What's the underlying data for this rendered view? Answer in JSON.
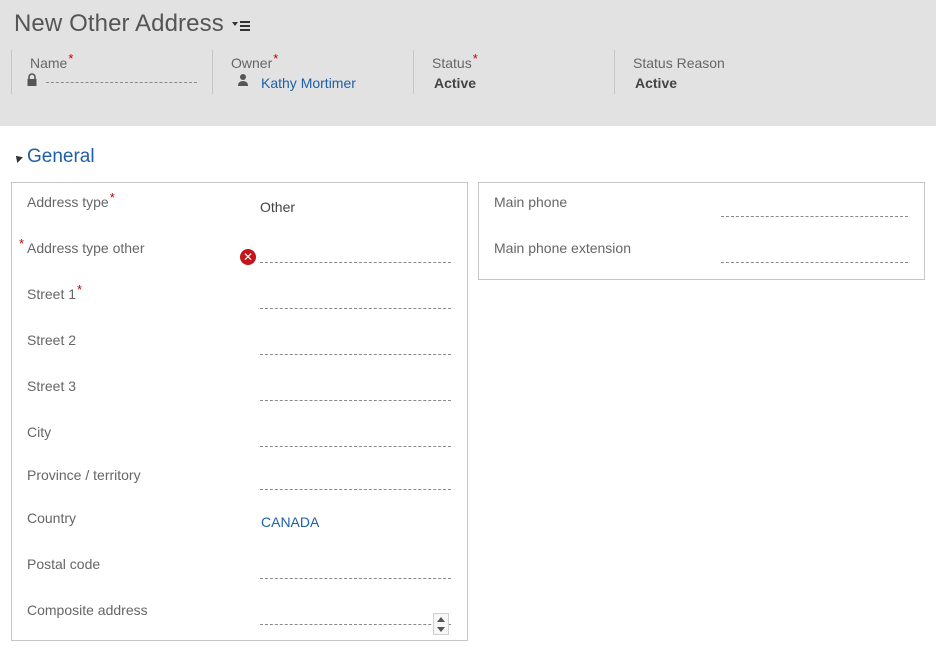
{
  "header": {
    "title": "New Other Address",
    "fields": [
      {
        "label": "Name",
        "required": "*",
        "value": ""
      },
      {
        "label": "Owner",
        "required": "*",
        "value": "Kathy Mortimer"
      },
      {
        "label": "Status",
        "required": "*",
        "value": "Active"
      },
      {
        "label": "Status Reason",
        "required": "",
        "value": "Active"
      }
    ]
  },
  "section": {
    "title": "General"
  },
  "left_fields": [
    {
      "label": "Address type",
      "required": "*",
      "value": "Other"
    },
    {
      "label": "Address type other",
      "required": "*",
      "value": ""
    },
    {
      "label": "Street 1",
      "required": "*",
      "value": ""
    },
    {
      "label": "Street 2",
      "value": ""
    },
    {
      "label": "Street 3",
      "value": ""
    },
    {
      "label": "City",
      "value": ""
    },
    {
      "label": "Province / territory",
      "value": ""
    },
    {
      "label": "Country",
      "value": "CANADA"
    },
    {
      "label": "Postal code",
      "value": ""
    },
    {
      "label": "Composite address",
      "value": ""
    }
  ],
  "right_fields": [
    {
      "label": "Main phone",
      "value": ""
    },
    {
      "label": "Main phone extension",
      "value": ""
    }
  ],
  "colors": {
    "header_bg": "#e2e2e2",
    "link": "#1f5fa8",
    "required": "#c00000",
    "error": "#c4151b"
  },
  "icons": {
    "form_menu": "list-menu-icon",
    "name_field": "lock-icon",
    "owner_field": "person-icon",
    "error": "error-x-icon",
    "section_toggle": "triangle-expanded-icon"
  }
}
